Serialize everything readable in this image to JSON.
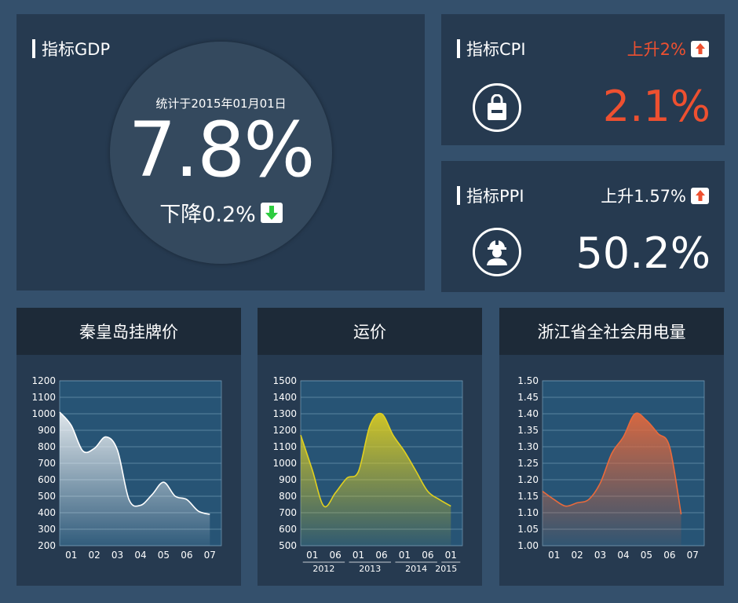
{
  "gdp": {
    "title": "指标GDP",
    "date": "统计于2015年01月01日",
    "value": "7.8%",
    "change": "下降0.2%",
    "change_color": "#2ecc40"
  },
  "cpi": {
    "title": "指标CPI",
    "change": "上升2%",
    "value": "2.1%",
    "accent": "#ee5030",
    "icon": "shopping-bag-icon"
  },
  "ppi": {
    "title": "指标PPI",
    "change": "上升1.57%",
    "value": "50.2%",
    "icon": "worker-icon"
  },
  "chart_data": [
    {
      "type": "area",
      "title": "秦皇岛挂牌价",
      "color": "#ffffff",
      "ylim": [
        200,
        1200
      ],
      "yticks": [
        200,
        300,
        400,
        500,
        600,
        700,
        800,
        900,
        1000,
        1100,
        1200
      ],
      "xticks": [
        "01",
        "02",
        "03",
        "04",
        "05",
        "06",
        "07"
      ],
      "x": [
        0,
        0.5,
        1,
        1.5,
        2,
        2.5,
        3,
        3.5,
        4,
        4.5,
        5,
        5.5,
        6,
        6.5
      ],
      "values": [
        1010,
        930,
        775,
        790,
        860,
        780,
        480,
        445,
        510,
        585,
        500,
        480,
        410,
        390
      ],
      "grid": true
    },
    {
      "type": "area",
      "title": "运价",
      "color": "#e0d020",
      "ylim": [
        500,
        1500
      ],
      "yticks": [
        500,
        600,
        700,
        800,
        900,
        1000,
        1100,
        1200,
        1300,
        1400,
        1500
      ],
      "xticks": [
        "01",
        "06",
        "01",
        "06",
        "01",
        "06",
        "01"
      ],
      "xgroups": [
        "2012",
        "2013",
        "2014",
        "2015"
      ],
      "x": [
        0,
        0.5,
        1,
        1.5,
        2,
        2.5,
        3,
        3.5,
        4,
        4.5,
        5,
        5.5,
        6,
        6.5
      ],
      "values": [
        1170,
        960,
        740,
        820,
        910,
        950,
        1230,
        1300,
        1170,
        1070,
        950,
        830,
        780,
        740
      ],
      "grid": true
    },
    {
      "type": "area",
      "title": "浙江省全社会用电量",
      "color": "#e86a3c",
      "ylim": [
        1.0,
        1.5
      ],
      "yticks": [
        "1.00",
        "1.05",
        "1.10",
        "1.15",
        "1.20",
        "1.25",
        "1.30",
        "1.35",
        "1.40",
        "1.45",
        "1.50"
      ],
      "xticks": [
        "01",
        "02",
        "03",
        "04",
        "05",
        "06",
        "07"
      ],
      "x": [
        0,
        0.5,
        1,
        1.5,
        2,
        2.5,
        3,
        3.5,
        4,
        4.5,
        5,
        5.5,
        6
      ],
      "values": [
        1.165,
        1.14,
        1.12,
        1.13,
        1.14,
        1.19,
        1.28,
        1.33,
        1.4,
        1.38,
        1.34,
        1.3,
        1.095
      ],
      "grid": true
    }
  ]
}
